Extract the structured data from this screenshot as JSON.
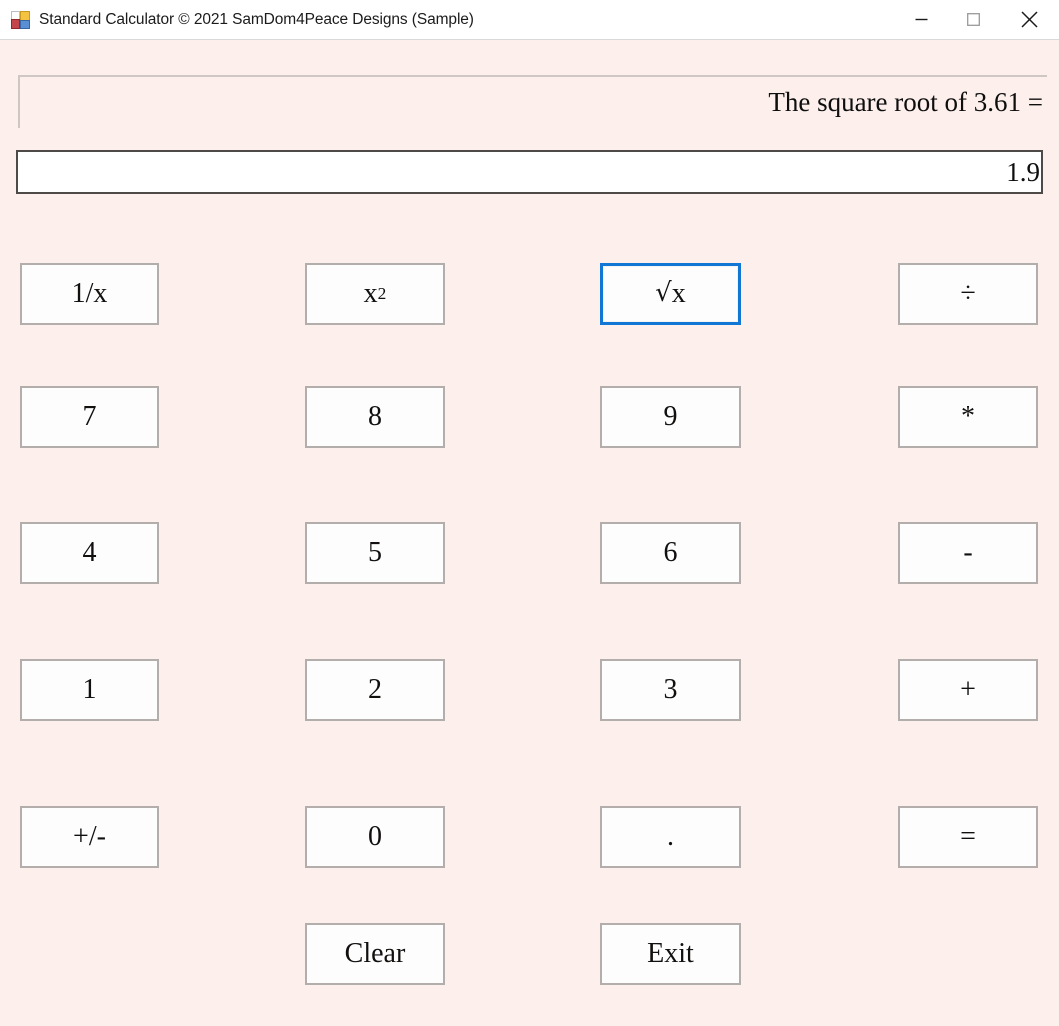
{
  "window": {
    "title": "Standard Calculator © 2021 SamDom4Peace Designs (Sample)",
    "icon": "app-window-icon",
    "background_color": "#fdf0ec",
    "controls": [
      {
        "name": "minimize",
        "glyph": "minimize-icon"
      },
      {
        "name": "maximize",
        "glyph": "maximize-icon"
      },
      {
        "name": "close",
        "glyph": "close-icon"
      }
    ]
  },
  "display": {
    "expression": "The square root of 3.61 =",
    "result": "1.9"
  },
  "accent": {
    "focus_border": "#1277d4",
    "button_border": "#b3aeac",
    "button_face": "#fdfdfd",
    "textbox_border": "#4e4a48"
  },
  "keypad": {
    "buttons": [
      {
        "id": "reciprocal",
        "label": "1/x",
        "focused": false
      },
      {
        "id": "square",
        "label": "x2",
        "html": "x<sup>2</sup>",
        "focused": false
      },
      {
        "id": "sqrt",
        "label": "√x",
        "html": "<span class=\"sqrt-glyph\">√</span>x",
        "focused": true
      },
      {
        "id": "divide",
        "label": "÷",
        "focused": false
      },
      {
        "id": "seven",
        "label": "7",
        "focused": false
      },
      {
        "id": "eight",
        "label": "8",
        "focused": false
      },
      {
        "id": "nine",
        "label": "9",
        "focused": false
      },
      {
        "id": "multiply",
        "label": "*",
        "focused": false
      },
      {
        "id": "four",
        "label": "4",
        "focused": false
      },
      {
        "id": "five",
        "label": "5",
        "focused": false
      },
      {
        "id": "six",
        "label": "6",
        "focused": false
      },
      {
        "id": "subtract",
        "label": "-",
        "focused": false
      },
      {
        "id": "one",
        "label": "1",
        "focused": false
      },
      {
        "id": "two",
        "label": "2",
        "focused": false
      },
      {
        "id": "three",
        "label": "3",
        "focused": false
      },
      {
        "id": "add",
        "label": "+",
        "focused": false
      },
      {
        "id": "sign",
        "label": "+/-",
        "focused": false
      },
      {
        "id": "zero",
        "label": "0",
        "focused": false
      },
      {
        "id": "decimal",
        "label": ".",
        "focused": false
      },
      {
        "id": "equals",
        "label": "=",
        "focused": false
      },
      {
        "id": "clear",
        "label": "Clear",
        "focused": false
      },
      {
        "id": "exit",
        "label": "Exit",
        "focused": false
      }
    ]
  }
}
